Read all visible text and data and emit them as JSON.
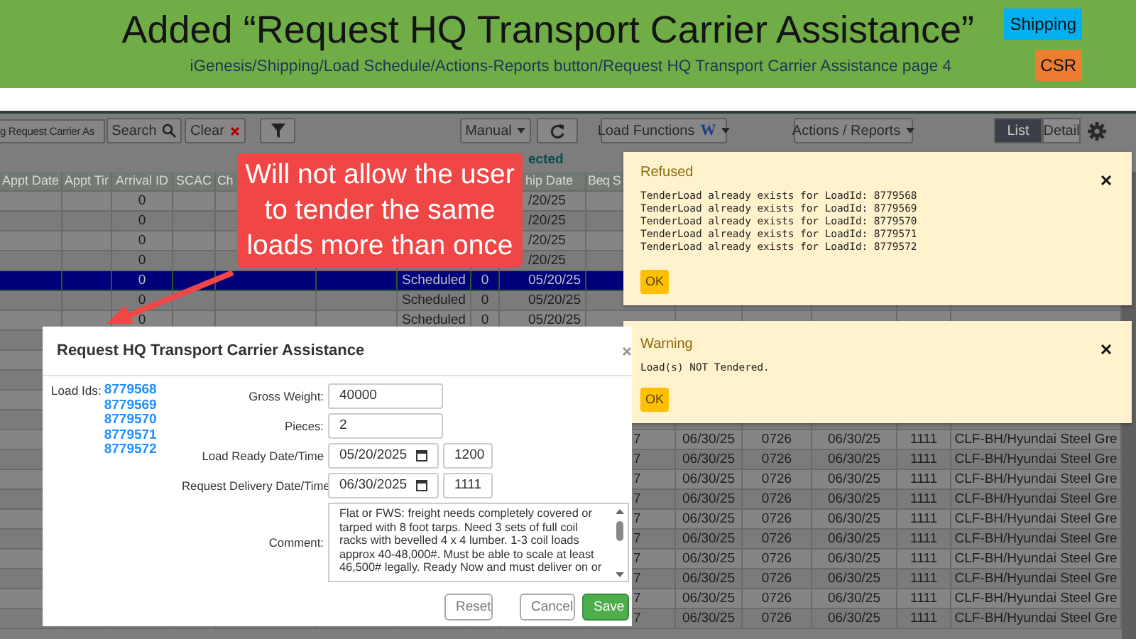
{
  "slide": {
    "title": "Added “Request HQ Transport Carrier Assistance”",
    "subtitle": "iGenesis/Shipping/Load Schedule/Actions-Reports button/Request HQ Transport Carrier Assistance page 4",
    "tags": [
      {
        "label": "Shipping",
        "color": "#00b0f0"
      },
      {
        "label": "CSR",
        "color": "#ed7d31"
      }
    ]
  },
  "toolbar": {
    "search_field": "g Request Carrier As",
    "search_button": "Search",
    "clear_button": "Clear",
    "manual_dropdown": "Manual",
    "load_functions": "Load Functions",
    "load_functions_mark": "W",
    "actions_reports": "Actions / Reports",
    "views": [
      {
        "label": "List",
        "selected": true
      },
      {
        "label": "Detail",
        "selected": false
      }
    ]
  },
  "grid": {
    "selection_label": "ected",
    "columns": [
      "Appt Date",
      "Appt Tir",
      "Arrival ID",
      "SCAC",
      "Ch",
      "hip Date",
      "Beq S"
    ],
    "rows": [
      {
        "kind": "partial",
        "selected": false,
        "cells": [
          "0",
          "/20/25"
        ]
      },
      {
        "kind": "partial",
        "selected": false,
        "cells": [
          "0",
          "/20/25"
        ]
      },
      {
        "kind": "partial",
        "selected": false,
        "cells": [
          "0",
          "/20/25"
        ]
      },
      {
        "kind": "partial",
        "selected": false,
        "cells": [
          "0",
          "/20/25"
        ]
      },
      {
        "kind": "scheduled",
        "selected": true,
        "cells": [
          "0",
          "Scheduled",
          "0",
          "05/20/25"
        ]
      },
      {
        "kind": "scheduled",
        "selected": false,
        "cells": [
          "0",
          "Scheduled",
          "0",
          "05/20/25"
        ]
      },
      {
        "kind": "scheduled",
        "selected": false,
        "cells": [
          "0",
          "Scheduled",
          "0",
          "05/20/25"
        ]
      },
      {
        "kind": "blank",
        "selected": false
      },
      {
        "kind": "blank",
        "selected": false
      },
      {
        "kind": "blank",
        "selected": false
      },
      {
        "kind": "blank",
        "selected": false
      },
      {
        "kind": "blank",
        "selected": false
      },
      {
        "kind": "right",
        "selected": false,
        "cells": [
          "7",
          "06/30/25",
          "0726",
          "06/30/25",
          "1111",
          "CLF-BH/Hyundai Steel Gre"
        ]
      },
      {
        "kind": "right",
        "selected": false,
        "cells": [
          "7",
          "06/30/25",
          "0726",
          "06/30/25",
          "1111",
          "CLF-BH/Hyundai Steel Gre"
        ]
      },
      {
        "kind": "right",
        "selected": false,
        "cells": [
          "7",
          "06/30/25",
          "0726",
          "06/30/25",
          "1111",
          "CLF-BH/Hyundai Steel Gre"
        ]
      },
      {
        "kind": "right",
        "selected": false,
        "cells": [
          "7",
          "06/30/25",
          "0726",
          "06/30/25",
          "1111",
          "CLF-BH/Hyundai Steel Gre"
        ]
      },
      {
        "kind": "right",
        "selected": false,
        "cells": [
          "7",
          "06/30/25",
          "0726",
          "06/30/25",
          "1111",
          "CLF-BH/Hyundai Steel Gre"
        ]
      },
      {
        "kind": "right",
        "selected": false,
        "cells": [
          "7",
          "06/30/25",
          "0726",
          "06/30/25",
          "1111",
          "CLF-BH/Hyundai Steel Gre"
        ]
      },
      {
        "kind": "right",
        "selected": false,
        "cells": [
          "7",
          "06/30/25",
          "0726",
          "06/30/25",
          "1111",
          "CLF-BH/Hyundai Steel Gre"
        ]
      },
      {
        "kind": "right",
        "selected": false,
        "cells": [
          "7",
          "06/30/25",
          "0726",
          "06/30/25",
          "1111",
          "CLF-BH/Hyundai Steel Gre"
        ]
      },
      {
        "kind": "right",
        "selected": false,
        "cells": [
          "7",
          "06/30/25",
          "0726",
          "06/30/25",
          "1111",
          "CLF-BH/Hyundai Steel Gre"
        ]
      },
      {
        "kind": "right",
        "selected": false,
        "cells": [
          "7",
          "06/30/25",
          "0726",
          "06/30/25",
          "1111",
          "CLF-BH/Hyundai Steel Gre"
        ]
      }
    ]
  },
  "callout": {
    "text": "Will not allow the user to tender the same loads more than once"
  },
  "alerts": [
    {
      "title": "Refused",
      "lines": [
        "TenderLoad already exists for LoadId: 8779568",
        "TenderLoad already exists for LoadId: 8779569",
        "TenderLoad already exists for LoadId: 8779570",
        "TenderLoad already exists for LoadId: 8779571",
        "TenderLoad already exists for LoadId: 8779572"
      ],
      "button": "OK"
    },
    {
      "title": "Warning",
      "lines": [
        "Load(s) NOT Tendered."
      ],
      "button": "OK"
    }
  ],
  "modal": {
    "title": "Request HQ Transport Carrier Assistance",
    "load_ids_label": "Load Ids:",
    "load_ids": [
      "8779568",
      "8779569",
      "8779570",
      "8779571",
      "8779572"
    ],
    "fields": [
      {
        "kind": "text",
        "label": "Gross Weight:",
        "value": "40000"
      },
      {
        "kind": "text",
        "label": "Pieces:",
        "value": "2"
      },
      {
        "kind": "datetime",
        "label": "Load Ready Date/Time",
        "date": "05/20/2025",
        "time": "1200"
      },
      {
        "kind": "datetime",
        "label": "Request Delivery Date/Time",
        "date": "06/30/2025",
        "time": "1111"
      },
      {
        "kind": "textarea",
        "label": "Comment:",
        "lines": [
          "Flat or FWS: freight needs completely covered or",
          "tarped with 8 foot tarps. Need 3 sets of full coil",
          "racks with bevelled 4 x 4 lumber. 1-3 coil loads",
          "approx 40-48,000#. Must be able to scale at least",
          "46,500# legally. Ready Now and must deliver on or"
        ]
      }
    ],
    "buttons": [
      {
        "kind": "default",
        "label": "Reset"
      },
      {
        "kind": "default",
        "label": "Cancel"
      },
      {
        "kind": "primary",
        "label": "Save"
      }
    ]
  }
}
